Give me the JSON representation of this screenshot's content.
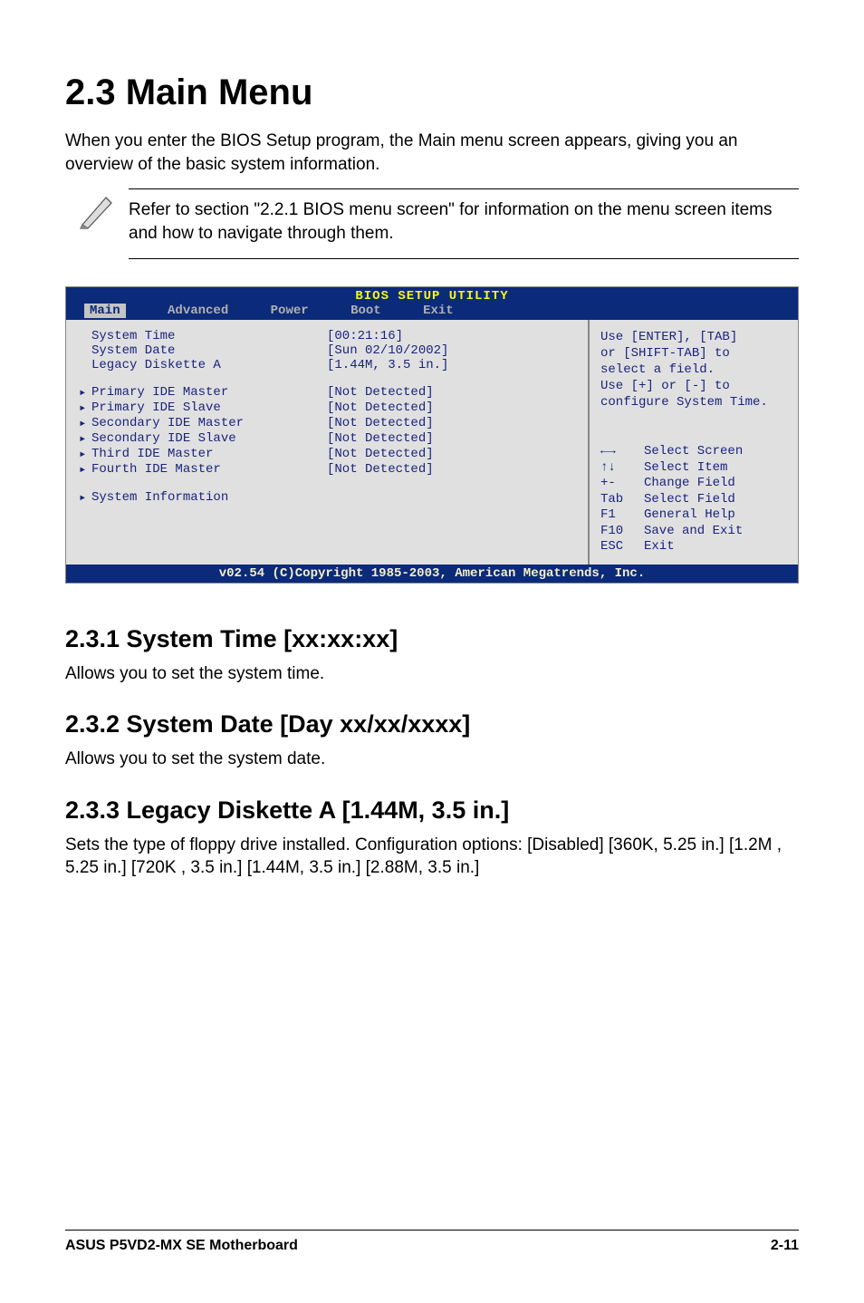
{
  "title": "2.3   Main Menu",
  "intro": "When you enter the BIOS Setup program, the Main menu screen appears, giving you an overview of the basic system information.",
  "note": "Refer to section \"2.2.1  BIOS menu screen\" for information on the menu screen items and how to navigate through them.",
  "bios": {
    "utility_title": "BIOS SETUP UTILITY",
    "tabs": [
      "Main",
      "Advanced",
      "Power",
      "Boot",
      "Exit"
    ],
    "top_rows": [
      {
        "label": "System Time",
        "value": "[00:21:16]"
      },
      {
        "label": "System Date",
        "value": "[Sun 02/10/2002]"
      },
      {
        "label": "Legacy Diskette A",
        "value": "[1.44M, 3.5 in.]"
      }
    ],
    "mid_rows": [
      {
        "label": "Primary IDE Master",
        "value": "[Not Detected]"
      },
      {
        "label": "Primary IDE Slave",
        "value": "[Not Detected]"
      },
      {
        "label": "Secondary IDE Master",
        "value": "[Not Detected]"
      },
      {
        "label": "Secondary IDE Slave",
        "value": "[Not Detected]"
      },
      {
        "label": "Third IDE Master",
        "value": "[Not Detected]"
      },
      {
        "label": "Fourth IDE Master",
        "value": "[Not Detected]"
      }
    ],
    "bottom_rows": [
      {
        "label": "System Information",
        "value": ""
      }
    ],
    "help_top": [
      "Use [ENTER], [TAB]",
      "or [SHIFT-TAB] to",
      "select a field.",
      "",
      "Use [+] or [-] to",
      "configure System Time."
    ],
    "help_keys": [
      {
        "k": "←→",
        "d": "Select Screen"
      },
      {
        "k": "↑↓",
        "d": "Select Item"
      },
      {
        "k": "+-",
        "d": "Change Field"
      },
      {
        "k": "Tab",
        "d": "Select Field"
      },
      {
        "k": "F1",
        "d": "General Help"
      },
      {
        "k": "F10",
        "d": "Save and Exit"
      },
      {
        "k": "ESC",
        "d": "Exit"
      }
    ],
    "footer": "v02.54 (C)Copyright 1985-2003, American Megatrends, Inc."
  },
  "sections": [
    {
      "heading": "2.3.1   System Time [xx:xx:xx]",
      "body": "Allows you to set the system time."
    },
    {
      "heading": "2.3.2   System Date [Day xx/xx/xxxx]",
      "body": "Allows you to set the system date."
    },
    {
      "heading": "2.3.3   Legacy Diskette A [1.44M, 3.5 in.]",
      "body": "Sets the type of floppy drive installed. Configuration options: [Disabled] [360K, 5.25 in.] [1.2M , 5.25 in.] [720K , 3.5 in.] [1.44M, 3.5 in.] [2.88M, 3.5 in.]"
    }
  ],
  "footer_left": "ASUS P5VD2-MX SE Motherboard",
  "footer_right": "2-11"
}
